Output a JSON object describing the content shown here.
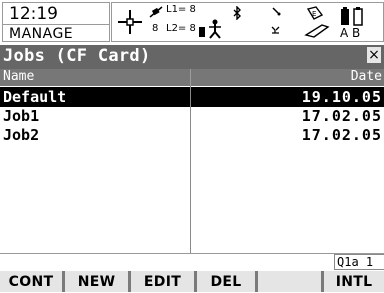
{
  "status": {
    "time": "12:19",
    "mode": "MANAGE",
    "sat_l1_count": "8",
    "sat_l1_label": "L1= 8",
    "sat_l2_label": "L2= 8",
    "sat_total": "8",
    "icon_battery_label": "A B"
  },
  "window": {
    "title": "Jobs (CF Card)",
    "close_label": "×"
  },
  "table": {
    "headers": {
      "name": "Name",
      "date": "Date"
    },
    "rows": [
      {
        "name": "Default",
        "date": "19.10.05",
        "selected": true
      },
      {
        "name": "Job1",
        "date": "17.02.05",
        "selected": false
      },
      {
        "name": "Job2",
        "date": "17.02.05",
        "selected": false
      }
    ]
  },
  "indicator": "Q1a 1",
  "function_keys": [
    "CONT",
    "NEW",
    "EDIT",
    "DEL",
    "",
    "INTL"
  ]
}
